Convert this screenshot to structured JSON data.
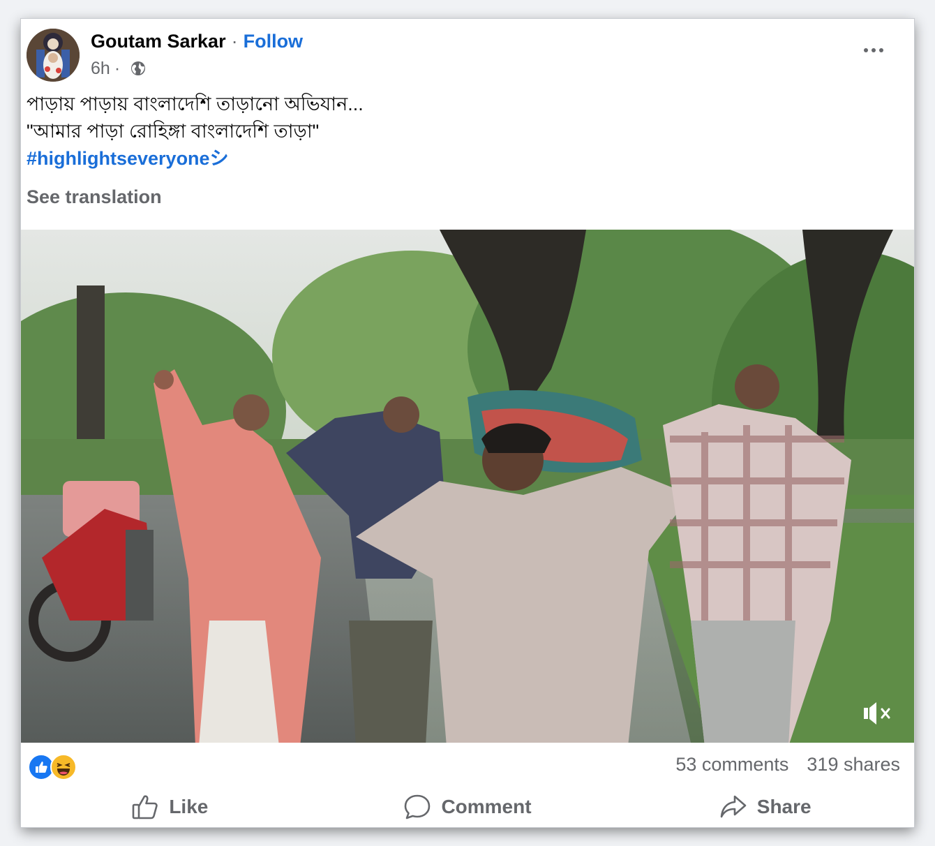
{
  "post": {
    "author": "Goutam Sarkar",
    "separator": "·",
    "follow_label": "Follow",
    "time": "6h",
    "meta_separator": "·",
    "privacy_icon": "globe-icon",
    "more_icon": "more-horizontal-icon",
    "text_line1": "পাড়ায় পাড়ায় বাংলাদেশি তাড়ানো অভিযান...",
    "text_line2": "\"আমার পাড়া রোহিঙ্গা বাংলাদেশি তাড়া\"",
    "hashtag": "#highlightseveryoneシ",
    "see_translation": "See translation"
  },
  "video": {
    "mute_icon": "volume-muted-icon"
  },
  "reactions": {
    "icons": [
      "like-reaction-icon",
      "haha-reaction-icon"
    ],
    "comments": "53 comments",
    "shares": "319 shares"
  },
  "actions": {
    "like": "Like",
    "comment": "Comment",
    "share": "Share"
  },
  "colors": {
    "link_blue": "#1a6ed8",
    "secondary_text": "#65676b",
    "like_blue": "#1877f2",
    "haha_yellow": "#f7b928"
  }
}
